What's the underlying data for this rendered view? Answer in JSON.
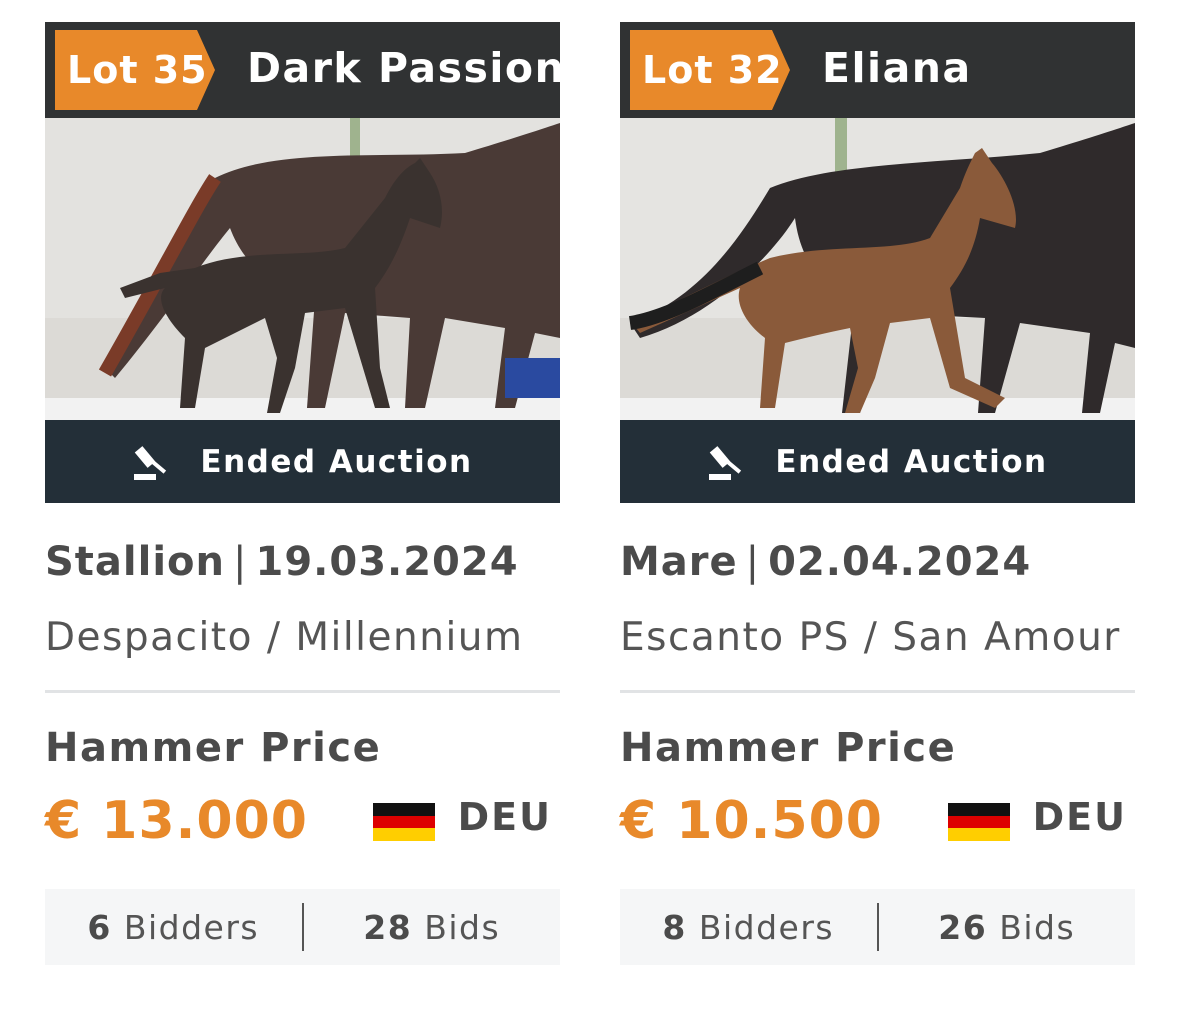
{
  "cards": [
    {
      "lot": "Lot 35",
      "name": "Dark Passion",
      "status": "Ended Auction",
      "gender": "Stallion",
      "separator": "|",
      "date": "19.03.2024",
      "pedigree": "Despacito / Millennium",
      "price_label": "Hammer Price",
      "price": "€ 13.000",
      "country": "DEU",
      "bidders_count": "6",
      "bidders_label": "Bidders",
      "bids_count": "28",
      "bids_label": "Bids"
    },
    {
      "lot": "Lot 32",
      "name": "Eliana",
      "status": "Ended Auction",
      "gender": "Mare",
      "separator": "|",
      "date": "02.04.2024",
      "pedigree": "Escanto PS / San Amour",
      "price_label": "Hammer Price",
      "price": "€ 10.500",
      "country": "DEU",
      "bidders_count": "8",
      "bidders_label": "Bidders",
      "bids_count": "26",
      "bids_label": "Bids"
    }
  ],
  "colors": {
    "accent_orange": "#e8892a",
    "header_dark": "#303233",
    "status_bar": "#232f38"
  },
  "icons": {
    "status": "gavel-icon",
    "country": "germany-flag-icon"
  }
}
